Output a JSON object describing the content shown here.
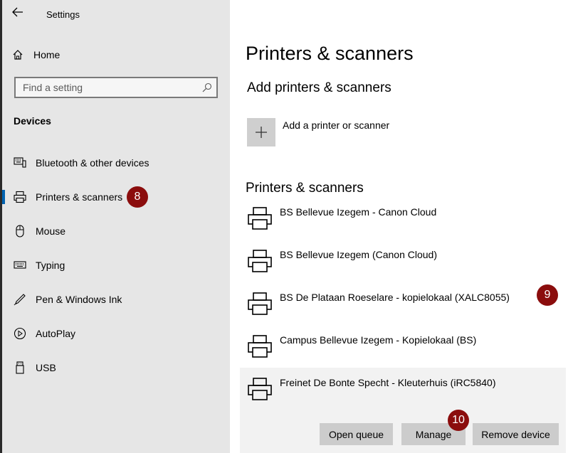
{
  "window": {
    "title": "Settings"
  },
  "sidebar": {
    "home_label": "Home",
    "search_placeholder": "Find a setting",
    "section_title": "Devices",
    "items": [
      {
        "label": "Bluetooth & other devices",
        "icon": "bluetooth-devices-icon"
      },
      {
        "label": "Printers & scanners",
        "icon": "printer-icon",
        "active": true
      },
      {
        "label": "Mouse",
        "icon": "mouse-icon"
      },
      {
        "label": "Typing",
        "icon": "keyboard-icon"
      },
      {
        "label": "Pen & Windows Ink",
        "icon": "pen-icon"
      },
      {
        "label": "AutoPlay",
        "icon": "autoplay-icon"
      },
      {
        "label": "USB",
        "icon": "usb-icon"
      }
    ]
  },
  "main": {
    "title": "Printers & scanners",
    "add_section_title": "Add printers & scanners",
    "add_label": "Add a printer or scanner",
    "list_title": "Printers & scanners",
    "printers": [
      "BS Bellevue Izegem - Canon Cloud",
      "BS Bellevue Izegem (Canon Cloud)",
      "BS De Plataan Roeselare - kopielokaal (XALC8055)",
      "Campus Bellevue Izegem - Kopielokaal (BS)",
      "Freinet De Bonte Specht - Kleuterhuis (iRC5840)"
    ],
    "actions": {
      "open_queue": "Open queue",
      "manage": "Manage",
      "remove": "Remove device"
    }
  },
  "annotations": {
    "badge_8": "8",
    "badge_9": "9",
    "badge_10": "10"
  },
  "colors": {
    "accent": "#0063b1",
    "badge": "#8b0d0d",
    "sidebar_bg": "#e6e6e6"
  }
}
